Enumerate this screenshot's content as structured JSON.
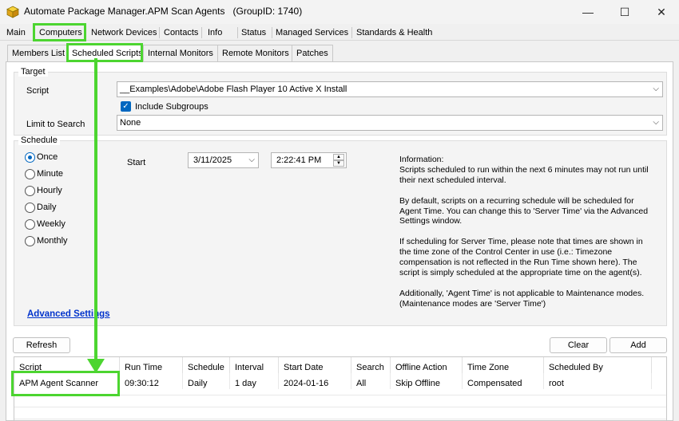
{
  "window": {
    "title": "Automate Package Manager.APM Scan Agents",
    "group_id": "(GroupID: 1740)",
    "minimize": "—",
    "maximize": "☐",
    "close": "✕"
  },
  "tabs": [
    "Main",
    "Computers",
    "Network Devices",
    "Contacts",
    "Info",
    "Status",
    "Managed Services",
    "Standards & Health"
  ],
  "subtabs": [
    "Members List",
    "Scheduled Scripts",
    "Internal Monitors",
    "Remote Monitors",
    "Patches"
  ],
  "target": {
    "group_label": "Target",
    "script_label": "Script",
    "script_value": "__Examples\\Adobe\\Adobe Flash Player 10 Active X Install",
    "include_subgroups": "Include Subgroups",
    "limit_label": "Limit to Search",
    "limit_value": "None"
  },
  "schedule": {
    "group_label": "Schedule",
    "options": [
      "Once",
      "Minute",
      "Hourly",
      "Daily",
      "Weekly",
      "Monthly"
    ],
    "selected": "Once",
    "start_label": "Start",
    "start_date": "3/11/2025",
    "start_time": "2:22:41 PM",
    "advanced_settings": "Advanced Settings",
    "info_text": "Information:\nScripts scheduled to run within the next 6 minutes may not run until\ntheir next scheduled interval.\n\nBy default, scripts on a recurring schedule will be scheduled for\nAgent Time. You can change this to 'Server Time' via the Advanced\nSettings window.\n\nIf scheduling for Server Time, please note that times are shown in\nthe time zone of the Control Center in use (i.e.: Timezone\ncompensation is not reflected in the Run Time shown here). The\nscript is simply scheduled at the appropriate time on the agent(s).\n\nAdditionally, 'Agent Time' is not applicable to Maintenance modes.\n(Maintenance modes are 'Server Time')"
  },
  "buttons": {
    "refresh": "Refresh",
    "clear": "Clear",
    "add": "Add"
  },
  "grid": {
    "columns": [
      "Script",
      "Run Time",
      "Schedule",
      "Interval",
      "Start Date",
      "Search",
      "Offline Action",
      "Time Zone",
      "Scheduled By"
    ],
    "rows": [
      [
        "APM Agent Scanner",
        "09:30:12",
        "Daily",
        "1 day",
        "2024-01-16",
        "All",
        "Skip Offline",
        "Compensated",
        "root"
      ]
    ]
  },
  "colors": {
    "highlight": "#4cd530",
    "accent": "#0067c0",
    "link": "#0033cc"
  }
}
